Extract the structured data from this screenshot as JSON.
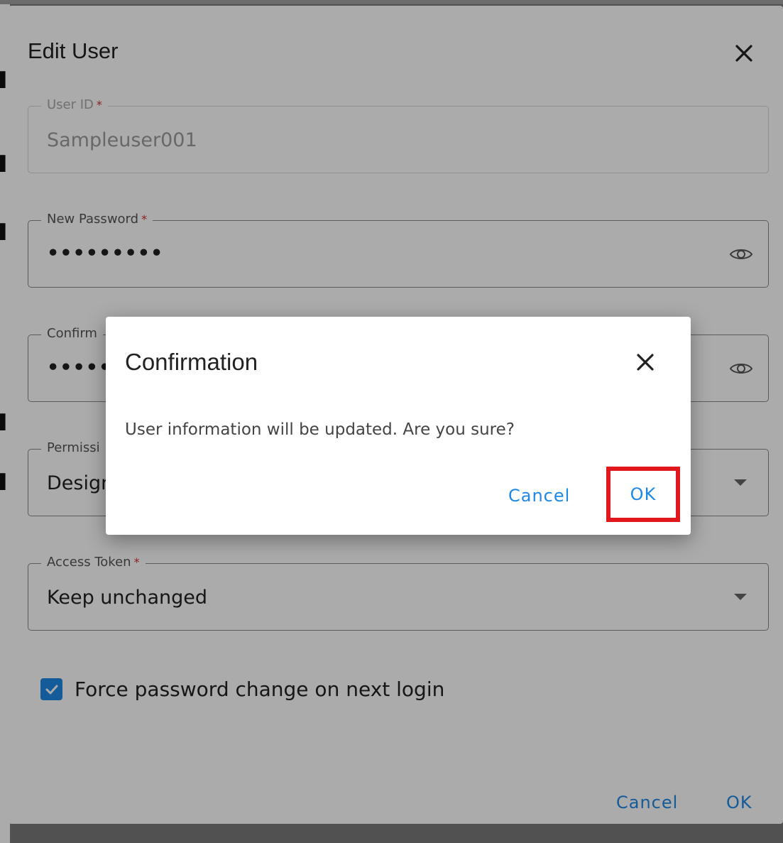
{
  "edit_dialog": {
    "title": "Edit User",
    "fields": {
      "user_id": {
        "label": "User ID",
        "value": "Sampleuser001"
      },
      "new_password": {
        "label": "New Password",
        "value": "•••••••••"
      },
      "confirm_password": {
        "label": "Confirm",
        "value": "•••••••••"
      },
      "permission": {
        "label": "Permissi",
        "value": "Design"
      },
      "access_token": {
        "label": "Access Token",
        "value": "Keep unchanged"
      }
    },
    "required_mark": "*",
    "checkbox": {
      "label": "Force password change on next login",
      "checked": true
    },
    "footer": {
      "cancel": "Cancel",
      "ok": "OK"
    }
  },
  "confirmation_dialog": {
    "title": "Confirmation",
    "message": "User information will be updated. Are you sure?",
    "cancel": "Cancel",
    "ok": "OK"
  },
  "colors": {
    "accent": "#1e88e5",
    "required": "#d32f2f",
    "highlight": "#e0181e"
  }
}
